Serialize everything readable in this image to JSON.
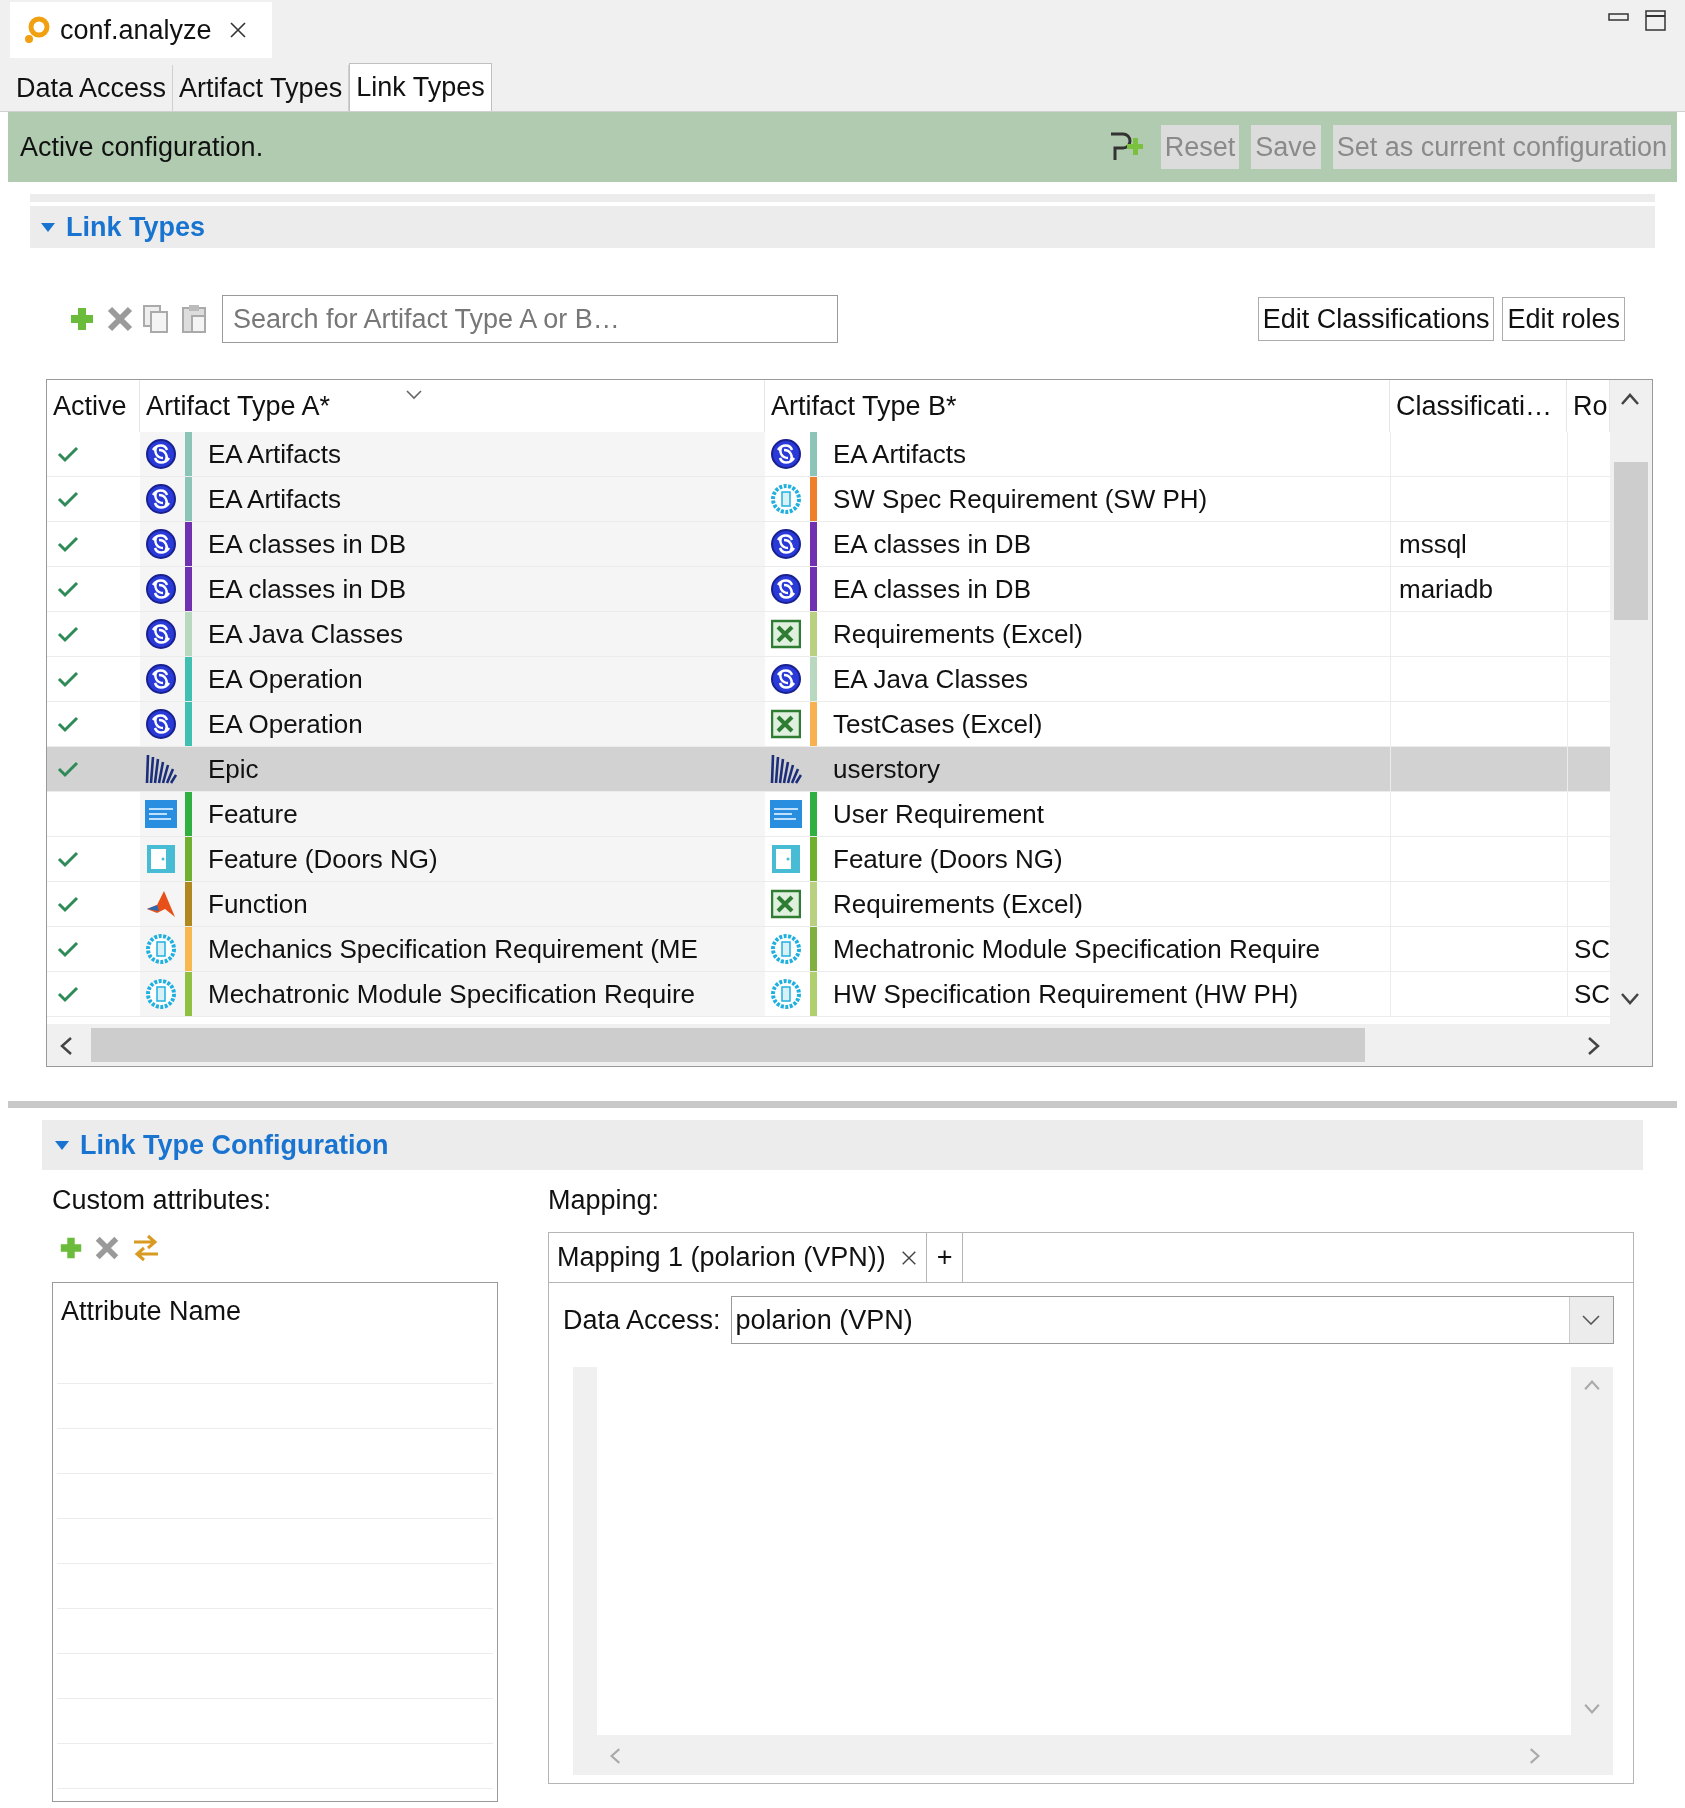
{
  "editor_tab": {
    "title": "conf.analyze"
  },
  "tabs": [
    {
      "label": "Data Access",
      "selected": false
    },
    {
      "label": "Artifact Types",
      "selected": false
    },
    {
      "label": "Link Types",
      "selected": true
    }
  ],
  "status_bar": {
    "message": "Active configuration.",
    "buttons": [
      {
        "label": "Reset",
        "disabled": true
      },
      {
        "label": "Save",
        "disabled": true
      },
      {
        "label": "Set as current configuration",
        "disabled": true
      }
    ]
  },
  "link_types": {
    "title": "Link Types",
    "expanded": true,
    "search": {
      "placeholder": "Search for Artifact Type A or B…"
    },
    "buttons": [
      "Edit Classifications",
      "Edit roles"
    ],
    "table": {
      "columns": [
        "Active",
        "Artifact Type A*",
        "Artifact Type B*",
        "Classificati…",
        "Ro"
      ],
      "rows": [
        {
          "active": true,
          "selected": false,
          "a": {
            "kind": "ea",
            "color": "#8cc4b8",
            "label": "EA Artifacts"
          },
          "b": {
            "kind": "ea",
            "color": "#8cc4b8",
            "label": "EA Artifacts"
          }
        },
        {
          "active": true,
          "selected": false,
          "a": {
            "kind": "ea",
            "color": "#8cc4b8",
            "label": "EA Artifacts"
          },
          "b": {
            "kind": "req",
            "color": "#f07f2c",
            "label": "SW Spec Requirement (SW PH)"
          }
        },
        {
          "active": true,
          "selected": false,
          "a": {
            "kind": "ea",
            "color": "#7030b0",
            "label": "EA classes in DB"
          },
          "b": {
            "kind": "ea",
            "color": "#7030b0",
            "label": "EA classes in DB"
          },
          "classification": "mssql"
        },
        {
          "active": true,
          "selected": false,
          "a": {
            "kind": "ea",
            "color": "#7030b0",
            "label": "EA classes in DB"
          },
          "b": {
            "kind": "ea",
            "color": "#7030b0",
            "label": "EA classes in DB"
          },
          "classification": "mariadb"
        },
        {
          "active": true,
          "selected": false,
          "a": {
            "kind": "ea",
            "color": "#b8d8c0",
            "label": "EA Java Classes"
          },
          "b": {
            "kind": "excel",
            "color": "#b8d080",
            "label": "Requirements (Excel)"
          }
        },
        {
          "active": true,
          "selected": false,
          "a": {
            "kind": "ea",
            "color": "#40c0b0",
            "label": "EA Operation"
          },
          "b": {
            "kind": "ea",
            "color": "#b8d8c0",
            "label": "EA Java Classes"
          }
        },
        {
          "active": true,
          "selected": false,
          "a": {
            "kind": "ea",
            "color": "#40c0b0",
            "label": "EA Operation"
          },
          "b": {
            "kind": "excel",
            "color": "#f8b050",
            "label": "TestCases (Excel)"
          }
        },
        {
          "active": true,
          "selected": true,
          "a": {
            "kind": "epic",
            "label": "Epic"
          },
          "b": {
            "kind": "epic",
            "label": "userstory"
          }
        },
        {
          "active": false,
          "selected": false,
          "a": {
            "kind": "ptc",
            "color": "#30b040",
            "label": "Feature"
          },
          "b": {
            "kind": "ptc",
            "color": "#30b040",
            "label": "User Requirement"
          }
        },
        {
          "active": true,
          "selected": false,
          "a": {
            "kind": "doors",
            "color": "#70b030",
            "label": "Feature (Doors NG)"
          },
          "b": {
            "kind": "doors",
            "color": "#70b030",
            "label": "Feature (Doors NG)"
          }
        },
        {
          "active": true,
          "selected": false,
          "a": {
            "kind": "matlab",
            "color": "#b08820",
            "label": "Function"
          },
          "b": {
            "kind": "excel",
            "color": "#b8d080",
            "label": "Requirements (Excel)"
          }
        },
        {
          "active": true,
          "selected": false,
          "a": {
            "kind": "req",
            "color": "#f8b850",
            "label": "Mechanics Specification Requirement (ME"
          },
          "b": {
            "kind": "req",
            "color": "#80b040",
            "label": "Mechatronic Module Specification Require"
          },
          "role": "SC"
        },
        {
          "active": true,
          "selected": false,
          "a": {
            "kind": "req",
            "color": "#90c040",
            "label": "Mechatronic Module Specification Require"
          },
          "b": {
            "kind": "req",
            "color": "#b0d070",
            "label": "HW Specification Requirement (HW PH)"
          },
          "role": "SC"
        }
      ]
    }
  },
  "link_type_configuration": {
    "title": "Link Type Configuration",
    "expanded": true,
    "custom_attributes": {
      "label": "Custom attributes:",
      "column": "Attribute Name"
    },
    "mapping": {
      "label": "Mapping:",
      "tabs": [
        {
          "label": "Mapping 1 (polarion (VPN))",
          "selected": true
        }
      ],
      "add_tab": "+",
      "data_access": {
        "label": "Data Access:",
        "value": "polarion (VPN)"
      }
    }
  }
}
